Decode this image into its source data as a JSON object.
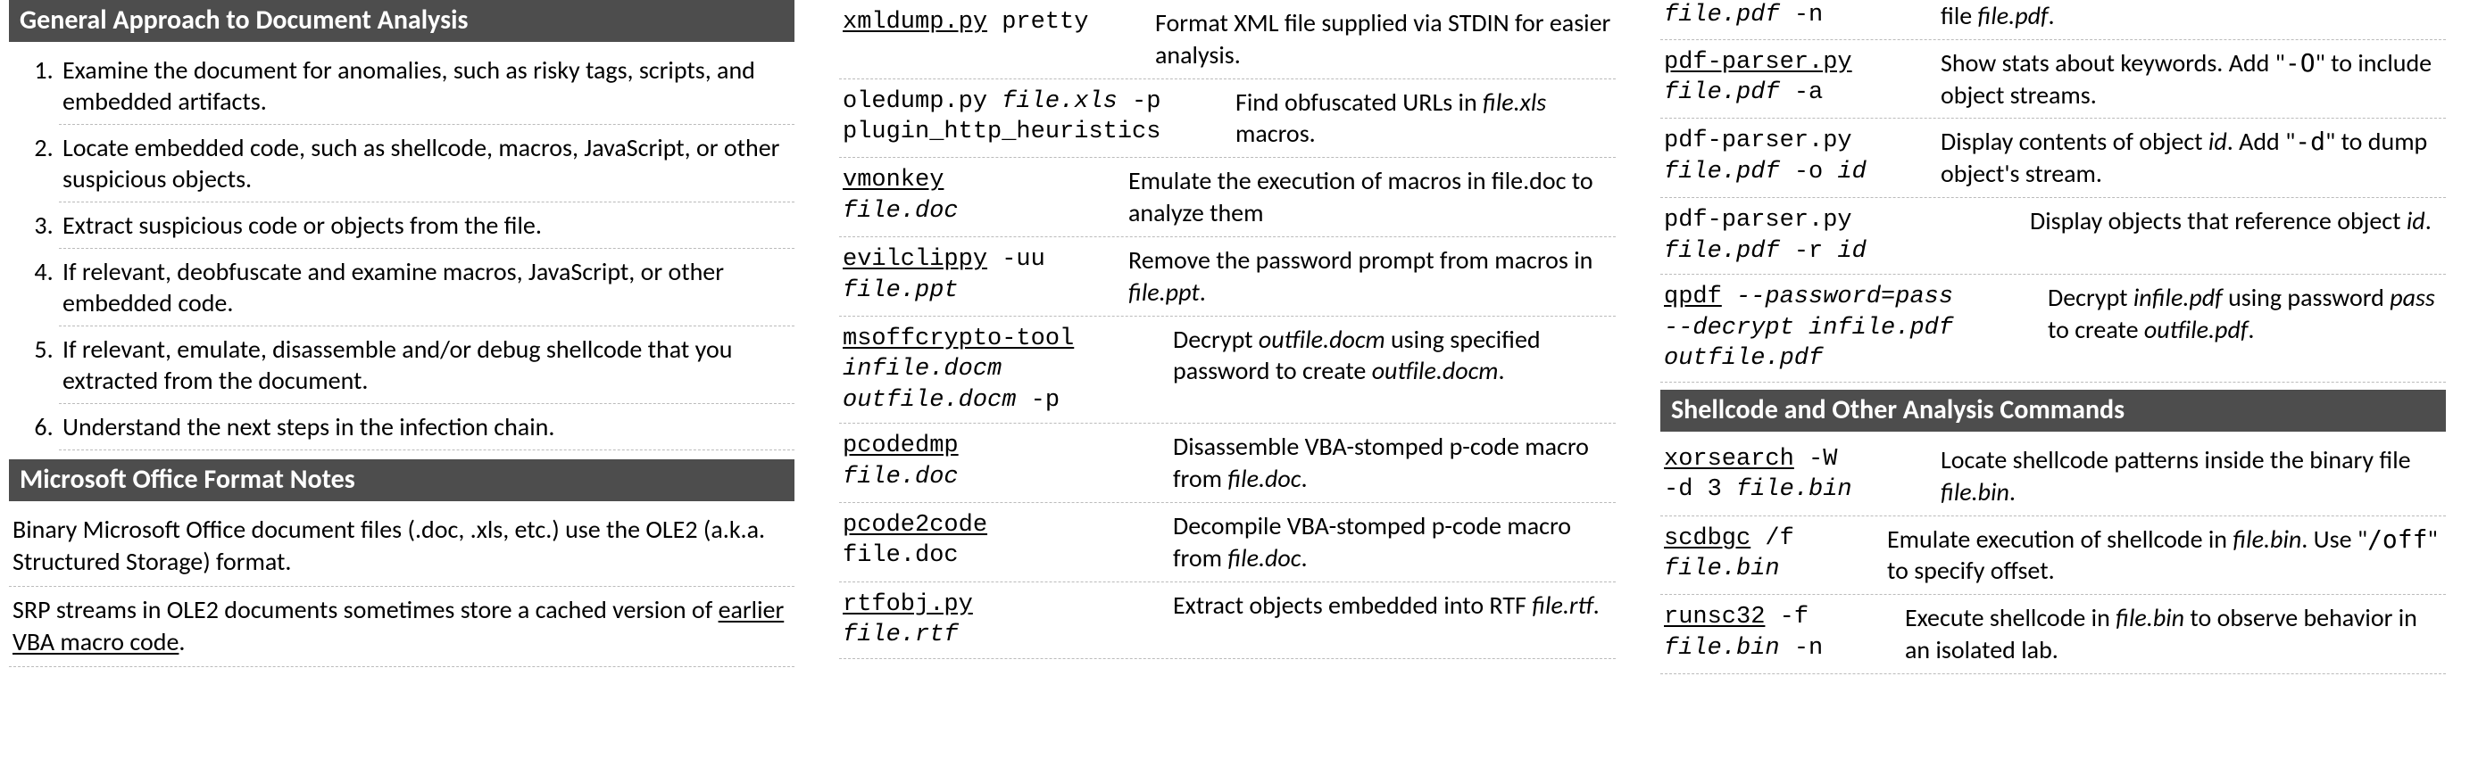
{
  "col1": {
    "header1": "General Approach to Document Analysis",
    "steps": [
      "Examine the document for anomalies, such as risky tags, scripts, and embedded artifacts.",
      "Locate embedded code, such as shellcode, macros, JavaScript, or other suspicious objects.",
      "Extract suspicious code or objects from the file.",
      "If relevant, deobfuscate and examine macros, JavaScript, or other embedded code.",
      "If relevant, emulate, disassemble and/or debug shellcode that you extracted from the document.",
      "Understand the next steps in the infection chain."
    ],
    "header2": "Microsoft Office Format Notes",
    "note1": "Binary Microsoft Office document files (.doc, .xls, etc.) use the OLE2 (a.k.a. Structured Storage) format.",
    "note2_a": "SRP streams in OLE2 documents sometimes store a cached version of ",
    "note2_link": "earlier VBA macro code",
    "note2_b": "."
  },
  "col2": {
    "rows": [
      {
        "cmd_tool": "xmldump.py",
        "cmd_rest": " pretty",
        "desc_plain": "Format XML file supplied via STDIN for easier analysis."
      },
      {
        "cmd_line1_a": "oledump.py ",
        "cmd_line1_ital": "file.xls",
        "cmd_line1_b": " -p",
        "cmd_line2": "plugin_http_heuristics",
        "desc_a": "Find obfuscated URLs in ",
        "desc_ital": "file.xls",
        "desc_b": " macros."
      },
      {
        "cmd_tool": "vmonkey",
        "cmd_line2_ital": "file.doc",
        "desc_plain": "Emulate the execution of macros in file.doc to analyze them"
      },
      {
        "cmd_tool": "evilclippy",
        "cmd_rest": " -uu",
        "cmd_line2_ital": "file.ppt",
        "desc_a": "Remove the password prompt from macros in ",
        "desc_ital": "file.ppt",
        "desc_b": "."
      },
      {
        "cmd_tool": "msoffcrypto-tool",
        "cmd_line2_ital": "infile.docm",
        "cmd_line3_ital": "outfile.docm",
        "cmd_line3_rest": " -p",
        "desc_a": "Decrypt ",
        "desc_ital": "outfile.docm",
        "desc_b": " using specified password to create ",
        "desc_ital2": "outfile.docm",
        "desc_c": "."
      },
      {
        "cmd_tool": "pcodedmp",
        "cmd_line2_ital": "file.doc",
        "desc_a": "Disassemble VBA-stomped p-code macro from ",
        "desc_ital": "file.doc",
        "desc_b": "."
      },
      {
        "cmd_tool": "pcode2code",
        "cmd_line2": "file.doc",
        "desc_a": "Decompile VBA-stomped p-code macro from ",
        "desc_ital": "file.doc",
        "desc_b": "."
      },
      {
        "cmd_tool": "rtfobj.py",
        "cmd_line2_ital": "file.rtf",
        "desc_a": "Extract objects embedded into RTF ",
        "desc_ital": "file.rtf",
        "desc_b": "."
      }
    ]
  },
  "col3": {
    "rows_a": [
      {
        "cmd_line1_ital": "file.pdf",
        "cmd_line1_rest": " -n",
        "desc_a": "file ",
        "desc_ital": "file.pdf",
        "desc_b": "."
      },
      {
        "cmd_tool": "pdf-parser.py",
        "cmd_line2_ital": "file.pdf",
        "cmd_line2_rest": " -a",
        "desc_a": "Show stats about keywords. Add \"",
        "desc_mono": "-O",
        "desc_b": "\" to include object streams."
      },
      {
        "cmd_line1": "pdf-parser.py",
        "cmd_line2_ital": "file.pdf",
        "cmd_line2_rest_a": " -o ",
        "cmd_line2_ital2": "id",
        "desc_a": "Display contents of object ",
        "desc_ital": "id",
        "desc_b": ". Add \"",
        "desc_mono": "-d",
        "desc_c": "\" to dump object's stream."
      },
      {
        "cmd_line1": "pdf-parser.py",
        "cmd_line2_ital": "file.pdf",
        "cmd_line2_rest_a": " -r ",
        "cmd_line2_ital2": "id",
        "desc_a": "Display objects that reference object ",
        "desc_ital": "id",
        "desc_b": "."
      },
      {
        "cmd_tool": "qpdf",
        "cmd_rest_a": " ",
        "cmd_rest_ital": "--password=pass",
        "cmd_line2_ital": "--decrypt infile.pdf",
        "cmd_line3_ital": "outfile.pdf",
        "desc_a": "Decrypt ",
        "desc_ital": "infile.pdf",
        "desc_b": " using password ",
        "desc_ital2": "pass",
        "desc_c": " to create ",
        "desc_ital3": "outfile.pdf",
        "desc_d": "."
      }
    ],
    "header": "Shellcode and Other Analysis Commands",
    "rows_b": [
      {
        "cmd_tool": "xorsearch",
        "cmd_rest": " -W",
        "cmd_line2_a": "-d 3 ",
        "cmd_line2_ital": "file.bin",
        "desc_a": "Locate shellcode patterns inside the binary file ",
        "desc_ital": "file.bin",
        "desc_b": "."
      },
      {
        "cmd_tool": "scdbgc",
        "cmd_rest": " /f",
        "cmd_line2_ital": "file.bin",
        "desc_a": "Emulate execution of shellcode in ",
        "desc_ital": "file.bin",
        "desc_b": ". Use \"",
        "desc_mono": "/off",
        "desc_c": "\" to specify offset."
      },
      {
        "cmd_tool": "runsc32",
        "cmd_rest": " -f",
        "cmd_line2_ital": "file.bin",
        "cmd_line2_rest": " -n",
        "desc_a": "Execute shellcode in ",
        "desc_ital": "file.bin",
        "desc_b": " to observe behavior in an isolated lab."
      }
    ]
  }
}
